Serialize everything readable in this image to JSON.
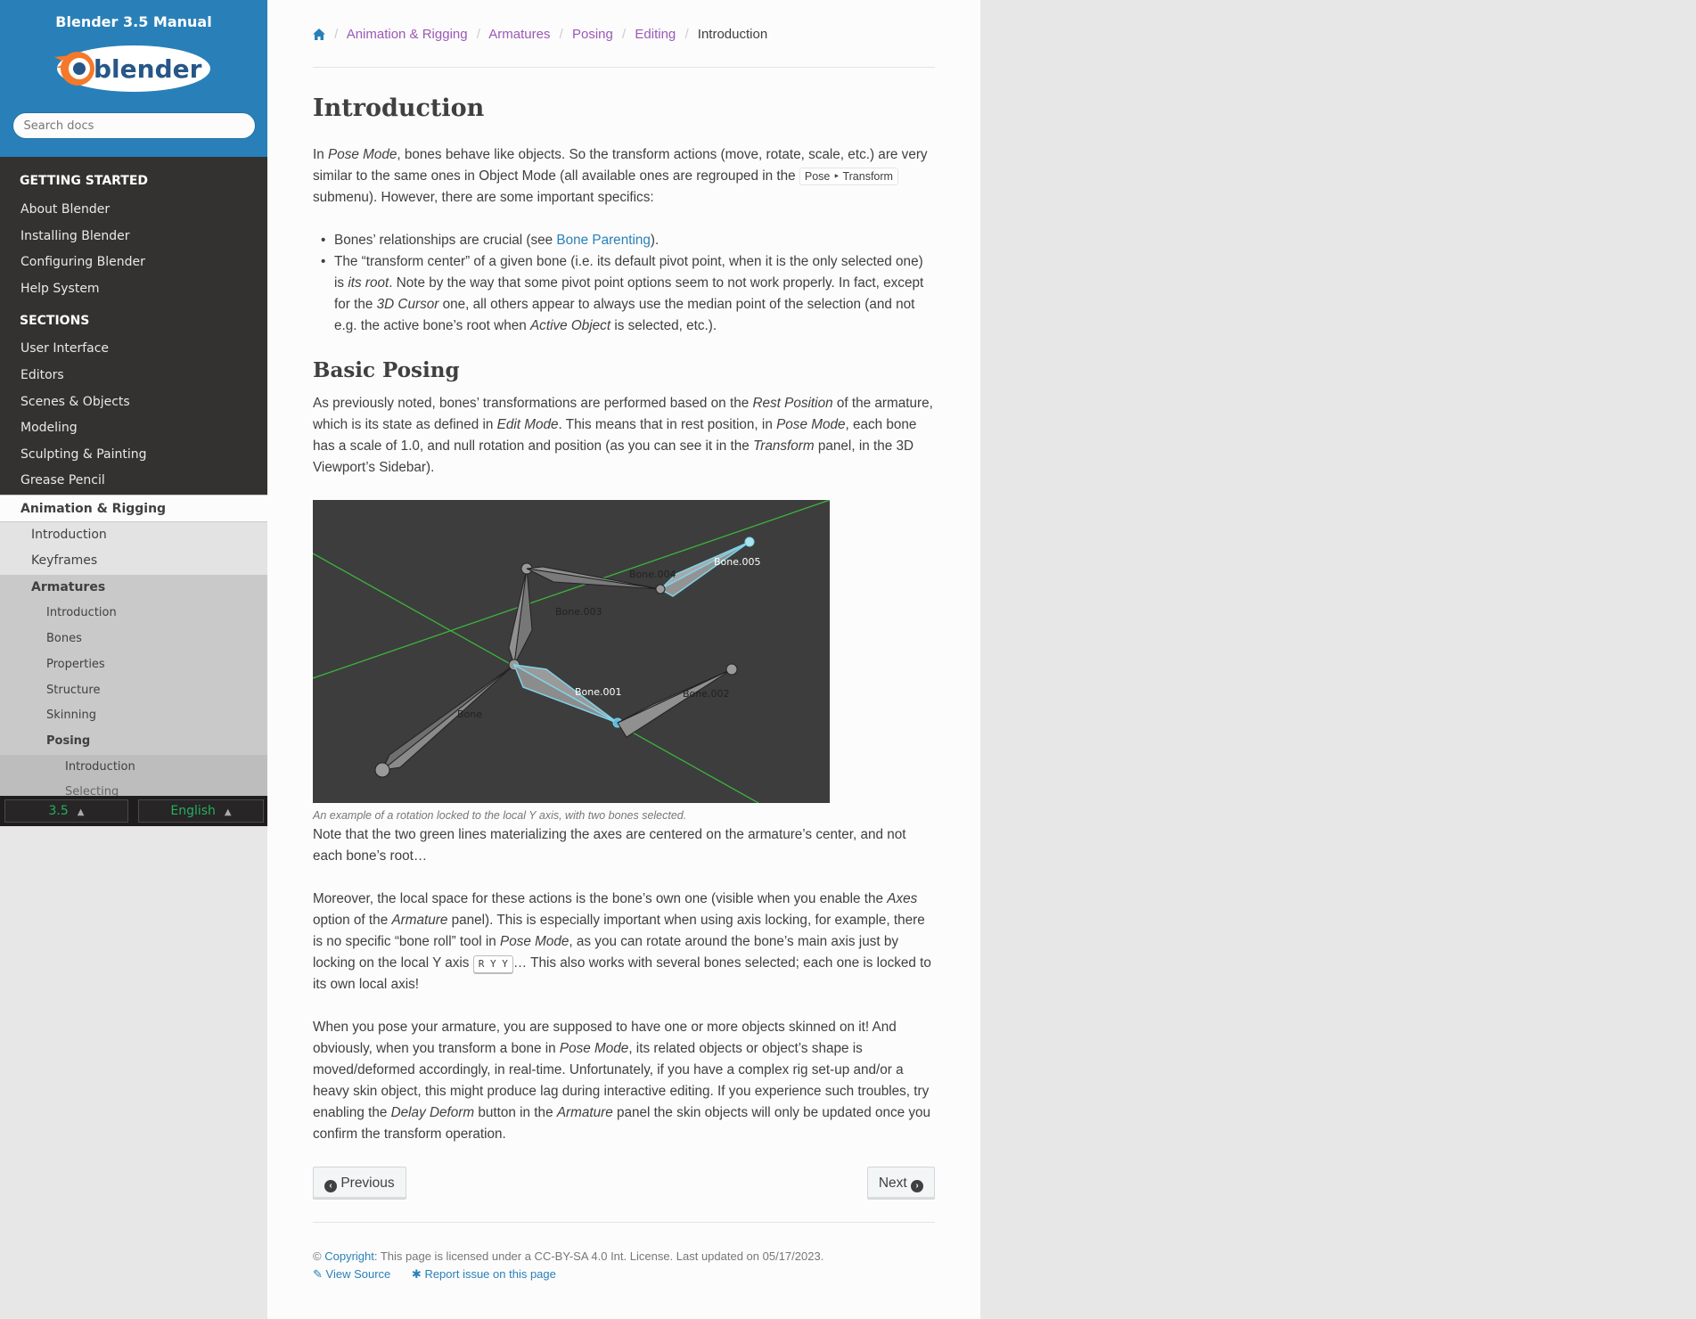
{
  "sidebar": {
    "title": "Blender 3.5 Manual",
    "logo_text": "blender",
    "search": {
      "placeholder": "Search docs"
    },
    "caption_getting_started": "GETTING STARTED",
    "getting_started": [
      "About Blender",
      "Installing Blender",
      "Configuring Blender",
      "Help System"
    ],
    "caption_sections": "SECTIONS",
    "sections": [
      "User Interface",
      "Editors",
      "Scenes & Objects",
      "Modeling",
      "Sculpting & Painting",
      "Grease Pencil"
    ],
    "current_section": "Animation & Rigging",
    "level2": {
      "intro": "Introduction",
      "keyframes": "Keyframes",
      "armatures": "Armatures"
    },
    "level3": [
      "Introduction",
      "Bones",
      "Properties",
      "Structure",
      "Skinning"
    ],
    "level3_current": "Posing",
    "level4": [
      "Introduction",
      "Selecting"
    ],
    "version": "3.5",
    "language": "English",
    "icon_arrow": "caret-up-icon"
  },
  "breadcrumb": {
    "home_icon": "home-icon",
    "items": [
      "Animation & Rigging",
      "Armatures",
      "Posing",
      "Editing"
    ],
    "current": "Introduction",
    "separator": "/"
  },
  "page": {
    "title": "Introduction",
    "intro": {
      "a": "In ",
      "b": "Pose Mode",
      "c": ", bones behave like objects. So the transform actions (move, rotate, scale, etc.) are very similar to the same ones in Object Mode (all available ones are regrouped in the ",
      "menu": "Pose ‣ Transform",
      "d": " submenu). However, there are some important specifics:"
    },
    "bullet1": {
      "a": "Bones’ relationships are crucial (see ",
      "link": "Bone Parenting",
      "b": ")."
    },
    "bullet2": {
      "a": "The “transform center” of a given bone (i.e. its default pivot point, when it is the only selected one) is ",
      "b": "its root",
      "c": ". Note by the way that some pivot point options seem to not work properly. In fact, except for the ",
      "d": "3D Cursor",
      "e": " one, all others appear to always use the median point of the selection (and not e.g. the active bone’s root when ",
      "f": "Active Object",
      "g": " is selected, etc.)."
    },
    "h2": "Basic Posing",
    "p1": {
      "a": "As previously noted, bones’ transformations are performed based on the ",
      "b": "Rest Position",
      "c": " of the armature, which is its state as defined in ",
      "d": "Edit Mode",
      "e": ". This means that in rest position, in ",
      "f": "Pose Mode",
      "g": ", each bone has a scale of 1.0, and null rotation and position (as you can see it in the ",
      "h": "Transform",
      "i": " panel, in the 3D Viewport’s Sidebar)."
    },
    "figure": {
      "labels": [
        "Bone.005",
        "Bone.004",
        "Bone.003",
        "Bone.001",
        "Bone.002",
        "Bone"
      ],
      "caption": "An example of a rotation locked to the local Y axis, with two bones selected."
    },
    "p2": "Note that the two green lines materializing the axes are centered on the armature’s center, and not each bone’s root…",
    "p3": {
      "a": "Moreover, the local space for these actions is the bone’s own one (visible when you enable the ",
      "b": "Axes",
      "c": " option of the ",
      "d": "Armature",
      "e": " panel). This is especially important when using axis locking, for example, there is no specific “bone roll” tool in ",
      "f": "Pose Mode",
      "g": ", as you can rotate around the bone’s main axis just by locking on the local Y axis ",
      "kbd": "R Y Y",
      "h": "… This also works with several bones selected; each one is locked to its own local axis!"
    },
    "p4": {
      "a": "When you pose your armature, you are supposed to have one or more objects skinned on it! And obviously, when you transform a bone in ",
      "b": "Pose Mode",
      "c": ", its related objects or object’s shape is moved/deformed accordingly, in real-time. Unfortunately, if you have a complex rig set-up and/or a heavy skin object, this might produce lag during interactive editing. If you experience such troubles, try enabling the ",
      "d": "Delay Deform",
      "e": " button in the ",
      "f": "Armature",
      "g": " panel the skin objects will only be updated once you confirm the transform operation."
    }
  },
  "pager": {
    "previous": "Previous",
    "next": "Next"
  },
  "footer": {
    "copy_symbol": "©",
    "copyright_link": "Copyright",
    "license": ": This page is licensed under a CC-BY-SA 4.0 Int. License. Last updated on 05/17/2023.",
    "view_source": "View Source",
    "report_issue": "Report issue on this page"
  },
  "colors": {
    "sidebar_top": "#2980b9",
    "sidebar_bg": "#343131",
    "link": "#2980b9",
    "visited": "#9b59b6",
    "annotation": "#e0101e",
    "axis_green": "#3cb43c",
    "selected_bone": "#7fd4e8"
  }
}
